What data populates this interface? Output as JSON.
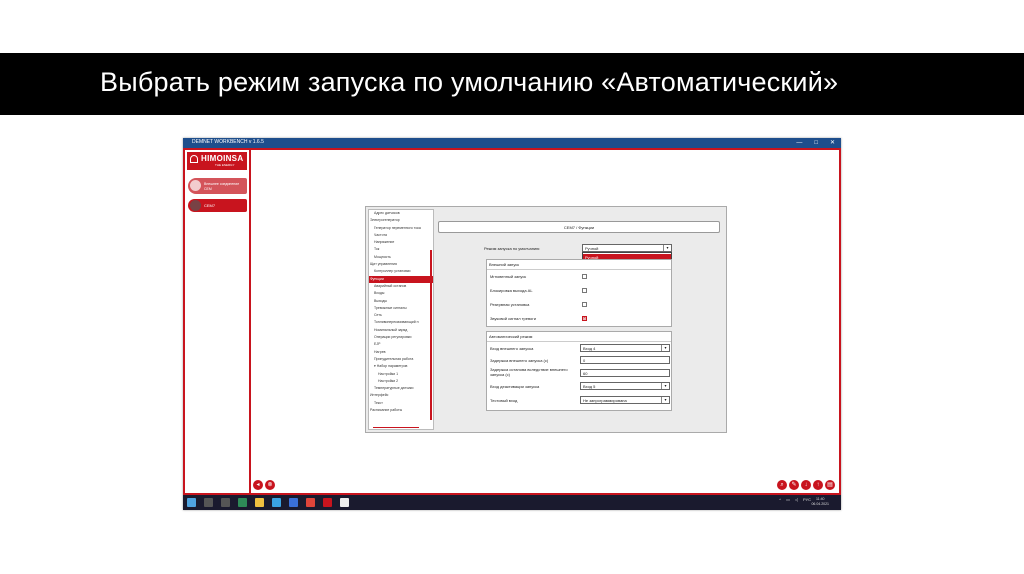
{
  "slide_title": "Выбрать режим запуска по умолчанию «Автоматический»",
  "window": {
    "title": "DEMNET WORKBENCH v 1.6.5"
  },
  "sidebar": {
    "logo": "HIMOINSA",
    "logo_sub": "THE ENERGY",
    "buttons": [
      {
        "label": "Внешнее соединение CEM"
      },
      {
        "label": "CEM7"
      }
    ]
  },
  "tree": {
    "items": [
      {
        "label": "Адрес датчиков",
        "level": 1
      },
      {
        "label": "Электрогенератор",
        "level": 0
      },
      {
        "label": "Генератор переменного тока",
        "level": 1
      },
      {
        "label": "Частота",
        "level": 1
      },
      {
        "label": "Напряжение",
        "level": 1
      },
      {
        "label": "Ток",
        "level": 1
      },
      {
        "label": "Мощность",
        "level": 1
      },
      {
        "label": "Щит управления",
        "level": 0
      },
      {
        "label": "Контроллер установки",
        "level": 1
      },
      {
        "label": "Функции",
        "level": 0,
        "selected": true
      },
      {
        "label": "Аварийный останов",
        "level": 1
      },
      {
        "label": "Входы",
        "level": 1
      },
      {
        "label": "Выходы",
        "level": 1
      },
      {
        "label": "Тревожные сигналы",
        "level": 1
      },
      {
        "label": "Сеть",
        "level": 1
      },
      {
        "label": "Топливоперекачивающий н",
        "level": 1
      },
      {
        "label": "Номинальный заряд",
        "level": 1
      },
      {
        "label": "Операции регулировки",
        "level": 1
      },
      {
        "label": "EJP",
        "level": 1
      },
      {
        "label": "Нагрев",
        "level": 1
      },
      {
        "label": "Принудительная работа",
        "level": 1
      },
      {
        "label": "▾ Набор параметров",
        "level": 1
      },
      {
        "label": "Настройки 1",
        "level": 2
      },
      {
        "label": "Настройки 2",
        "level": 2
      },
      {
        "label": "Температурные датчики",
        "level": 1
      },
      {
        "label": "Интерфейс",
        "level": 0
      },
      {
        "label": "Текст",
        "level": 1
      },
      {
        "label": "Расписание работы",
        "level": 0
      }
    ]
  },
  "content": {
    "header": "CEM7 / Функции",
    "default_mode": {
      "label": "Режим запуска по умолчанию:",
      "value": "Ручной",
      "options": [
        "Ручной",
        "Автоматический"
      ]
    },
    "external_start": {
      "title": "Внешний запуск",
      "rows": [
        {
          "label": "Мгновенный запуск",
          "checked": false
        },
        {
          "label": "Блокировка выхода AL",
          "checked": false
        },
        {
          "label": "Резервная установка",
          "checked": false
        },
        {
          "label": "Звуковой сигнал тревоги",
          "checked": true
        }
      ]
    },
    "auto_mode": {
      "title": "Автоматический режим",
      "rows": [
        {
          "label": "Вход внешнего запуска",
          "type": "select",
          "value": "Вход 4"
        },
        {
          "label": "Задержка внешнего запуска (с)",
          "type": "input",
          "value": "0"
        },
        {
          "label": "Задержка останова вследствие внешнего запуска (с)",
          "type": "input",
          "value": "60"
        },
        {
          "label": "Вход деактивации запуска",
          "type": "select",
          "value": "Вход 5"
        },
        {
          "label": "Тестовый вход",
          "type": "select",
          "value": "Не запрограммирована"
        }
      ]
    }
  },
  "taskbar": {
    "lang": "РУС",
    "time": "11:40",
    "date": "06.04.2021"
  },
  "colors": {
    "accent": "#c8141e",
    "titlebar": "#1e4e8c",
    "taskbar": "#1a1a2e"
  }
}
